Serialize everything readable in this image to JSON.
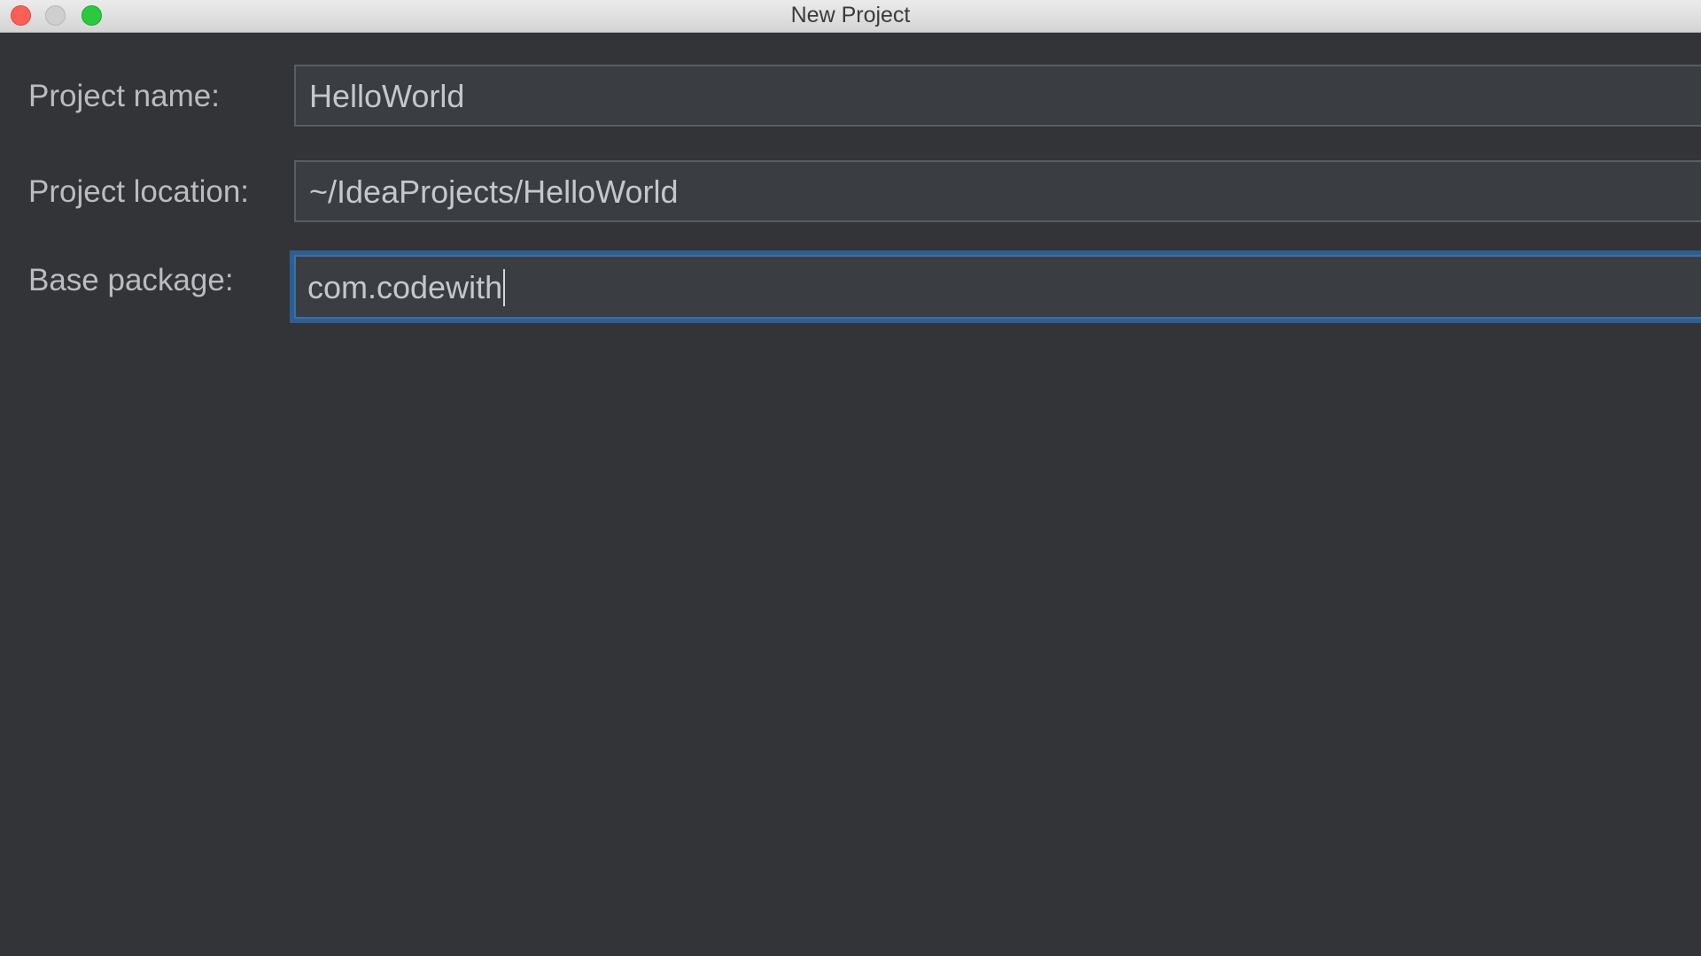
{
  "window": {
    "title": "New Project"
  },
  "form": {
    "project_name": {
      "label": "Project name:",
      "value": "HelloWorld"
    },
    "project_location": {
      "label": "Project location:",
      "value": "~/IdeaProjects/HelloWorld"
    },
    "base_package": {
      "label": "Base package:",
      "value": "com.codewith"
    }
  },
  "colors": {
    "background": "#323438",
    "field_background": "#3a3e42",
    "focus_border": "#2f5f92",
    "label_text": "#b9bcc1"
  },
  "icons": {
    "close": "close-icon",
    "minimize": "minimize-icon",
    "zoom": "zoom-icon"
  }
}
